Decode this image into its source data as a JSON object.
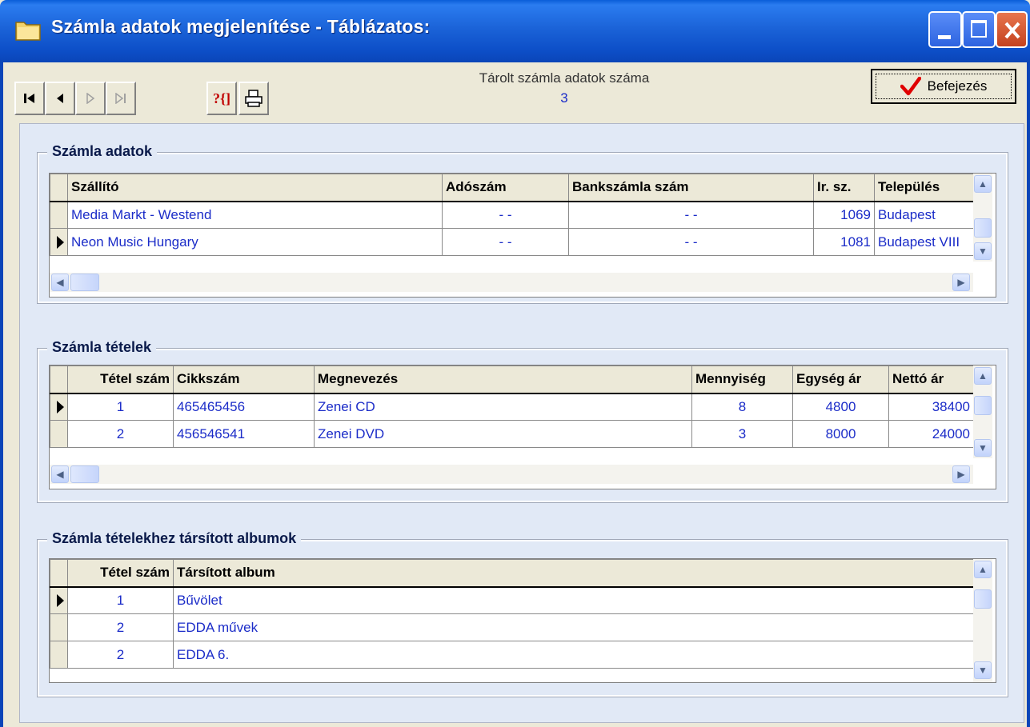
{
  "window": {
    "title": "Számla adatok megjelenítése - Táblázatos:",
    "minimize_icon": "minimize-icon",
    "maximize_icon": "maximize-icon",
    "close_icon": "close-icon"
  },
  "toolbar": {
    "nav_buttons": [
      {
        "name": "first-record-button",
        "glyph": "|◄"
      },
      {
        "name": "prev-record-button",
        "glyph": "◄"
      },
      {
        "name": "next-record-button",
        "glyph": "▷"
      },
      {
        "name": "last-record-button",
        "glyph": "▷|"
      }
    ],
    "query_glyph": "?{]",
    "print_icon": "printer-icon",
    "count_label": "Tárolt számla adatok száma",
    "count_value": "3",
    "finish_label": "Befejezés",
    "finish_icon": "checkmark-icon"
  },
  "invoice": {
    "title": "Számla adatok",
    "columns": [
      "Szállító",
      "Adószám",
      "Bankszámla szám",
      "Ir. sz.",
      "Település"
    ],
    "rows": [
      {
        "selected": false,
        "cells": [
          "Media Markt - Westend",
          "  -  -  ",
          "-       -",
          "1069",
          "Budapest"
        ]
      },
      {
        "selected": true,
        "cells": [
          "Neon Music Hungary",
          "  -  -  ",
          "-       -",
          "1081",
          "Budapest VIII"
        ]
      }
    ]
  },
  "items": {
    "title": "Számla tételek",
    "columns": [
      "Tétel szám",
      "Cikkszám",
      "Megnevezés",
      "Mennyiség",
      "Egység ár",
      "Nettó ár"
    ],
    "rows": [
      {
        "selected": true,
        "cells": [
          "1",
          "465465456",
          "Zenei CD",
          "8",
          "4800",
          "38400"
        ]
      },
      {
        "selected": false,
        "cells": [
          "2",
          "456546541",
          "Zenei DVD",
          "3",
          "8000",
          "24000"
        ]
      }
    ]
  },
  "albums": {
    "title": "Számla tételekhez társított albumok",
    "columns": [
      "Tétel szám",
      "Társított album"
    ],
    "rows": [
      {
        "selected": true,
        "cells": [
          "1",
          "Bűvölet"
        ]
      },
      {
        "selected": false,
        "cells": [
          "2",
          "EDDA művek"
        ]
      },
      {
        "selected": false,
        "cells": [
          "2",
          "EDDA 6."
        ]
      }
    ]
  },
  "colors": {
    "titlebar": "#0a5ed9",
    "cell_text": "#1b2cc8",
    "panel": "#e1e9f6",
    "window_bg": "#ece9d8"
  }
}
